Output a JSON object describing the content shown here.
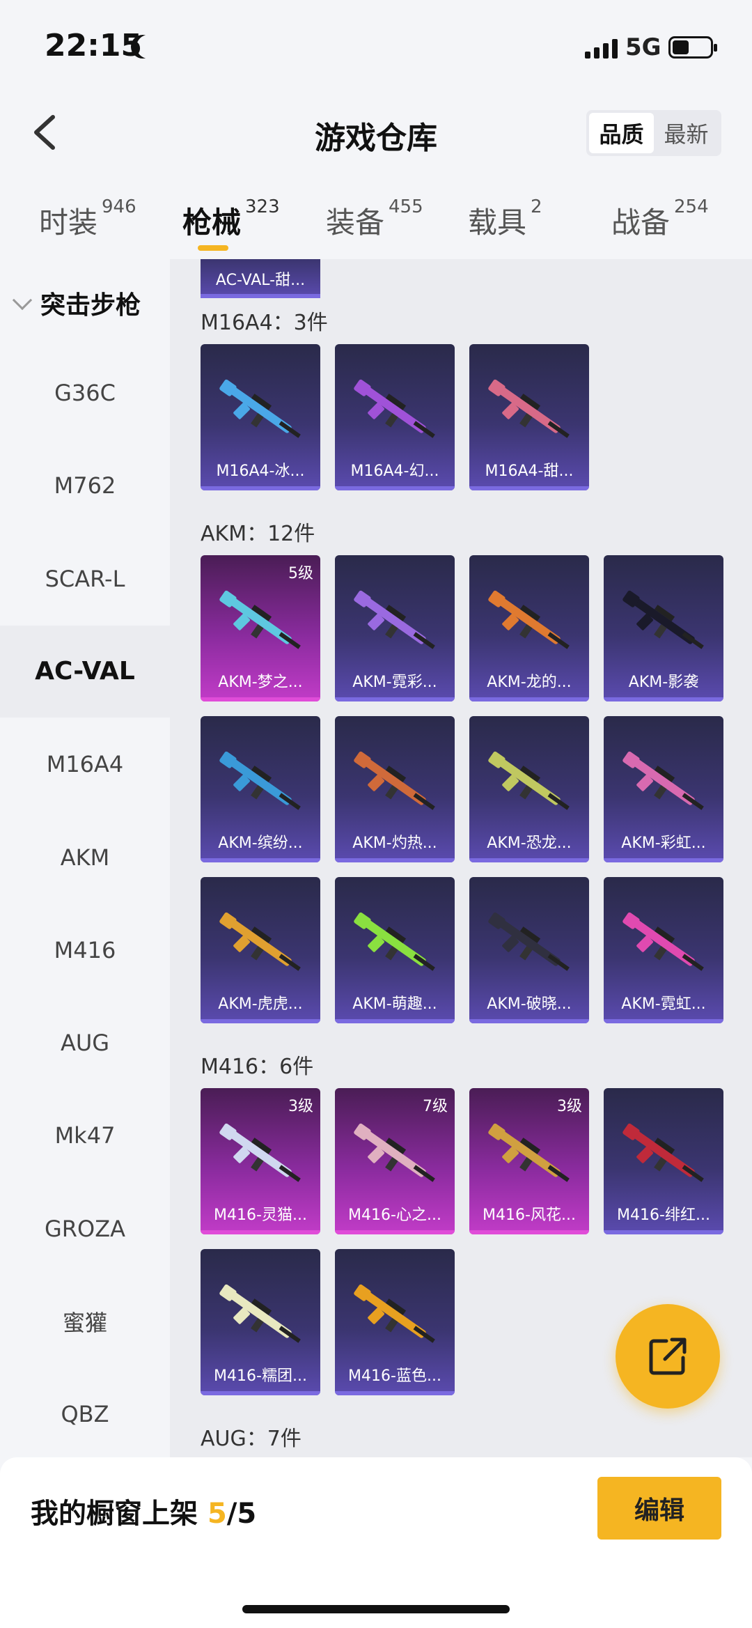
{
  "status": {
    "time": "22:15",
    "network": "5G",
    "battery_level": 0.45
  },
  "header": {
    "title": "游戏仓库",
    "sort_options": [
      "品质",
      "最新"
    ],
    "sort_selected": "品质"
  },
  "tabs": [
    {
      "label": "时装",
      "count": "946"
    },
    {
      "label": "枪械",
      "count": "323",
      "active": true
    },
    {
      "label": "装备",
      "count": "455"
    },
    {
      "label": "载具",
      "count": "2"
    },
    {
      "label": "战备",
      "count": "254"
    }
  ],
  "sidebar": {
    "group": "突击步枪",
    "items": [
      "G36C",
      "M762",
      "SCAR-L",
      "AC-VAL",
      "M16A4",
      "AKM",
      "M416",
      "AUG",
      "Mk47",
      "GROZA",
      "蜜獾",
      "QBZ"
    ],
    "active": "AC-VAL"
  },
  "content": {
    "partial_card": "AC-VAL-甜...",
    "sections": [
      {
        "title": "M16A4：3件",
        "cards": [
          {
            "name": "M16A4-冰...",
            "grade": "",
            "color": "#4aa8e8"
          },
          {
            "name": "M16A4-幻...",
            "grade": "",
            "color": "#a052d8"
          },
          {
            "name": "M16A4-甜...",
            "grade": "",
            "color": "#d86a88"
          }
        ]
      },
      {
        "title": "AKM：12件",
        "cards": [
          {
            "name": "AKM-梦之...",
            "grade": "5级",
            "color": "#5ec8e0",
            "pink": true
          },
          {
            "name": "AKM-霓彩...",
            "grade": "",
            "color": "#9a6ae0"
          },
          {
            "name": "AKM-龙的...",
            "grade": "",
            "color": "#e07a30"
          },
          {
            "name": "AKM-影袭",
            "grade": "",
            "color": "#1a1a2a"
          },
          {
            "name": "AKM-缤纷...",
            "grade": "",
            "color": "#3a9ad8"
          },
          {
            "name": "AKM-灼热...",
            "grade": "",
            "color": "#d06a3a"
          },
          {
            "name": "AKM-恐龙...",
            "grade": "",
            "color": "#c0c860"
          },
          {
            "name": "AKM-彩虹...",
            "grade": "",
            "color": "#d86ab0"
          },
          {
            "name": "AKM-虎虎...",
            "grade": "",
            "color": "#e0a030"
          },
          {
            "name": "AKM-萌趣...",
            "grade": "",
            "color": "#8ae040"
          },
          {
            "name": "AKM-破晓...",
            "grade": "",
            "color": "#303040"
          },
          {
            "name": "AKM-霓虹...",
            "grade": "",
            "color": "#e04ab0"
          }
        ]
      },
      {
        "title": "M416：6件",
        "cards": [
          {
            "name": "M416-灵猫...",
            "grade": "3级",
            "color": "#d0d8f0",
            "pink": true
          },
          {
            "name": "M416-心之...",
            "grade": "7级",
            "color": "#e0b0c0",
            "pink": true
          },
          {
            "name": "M416-风花...",
            "grade": "3级",
            "color": "#d0a040",
            "pink": true
          },
          {
            "name": "M416-绯红...",
            "grade": "",
            "color": "#c02a3a"
          },
          {
            "name": "M416-糯团...",
            "grade": "",
            "color": "#e8e8c0"
          },
          {
            "name": "M416-蓝色...",
            "grade": "",
            "color": "#e8a020"
          }
        ]
      },
      {
        "title": "AUG：7件",
        "cards": []
      }
    ]
  },
  "bottom": {
    "label": "我的橱窗上架 ",
    "current": "5",
    "separator": "/",
    "total": "5",
    "edit_label": "编辑"
  },
  "colors": {
    "accent": "#f5b522",
    "card_purple": "#5b4bb0",
    "card_pink": "#c23cc8"
  },
  "icons": {
    "back": "chevron-left-icon",
    "fab": "share-external-icon"
  }
}
